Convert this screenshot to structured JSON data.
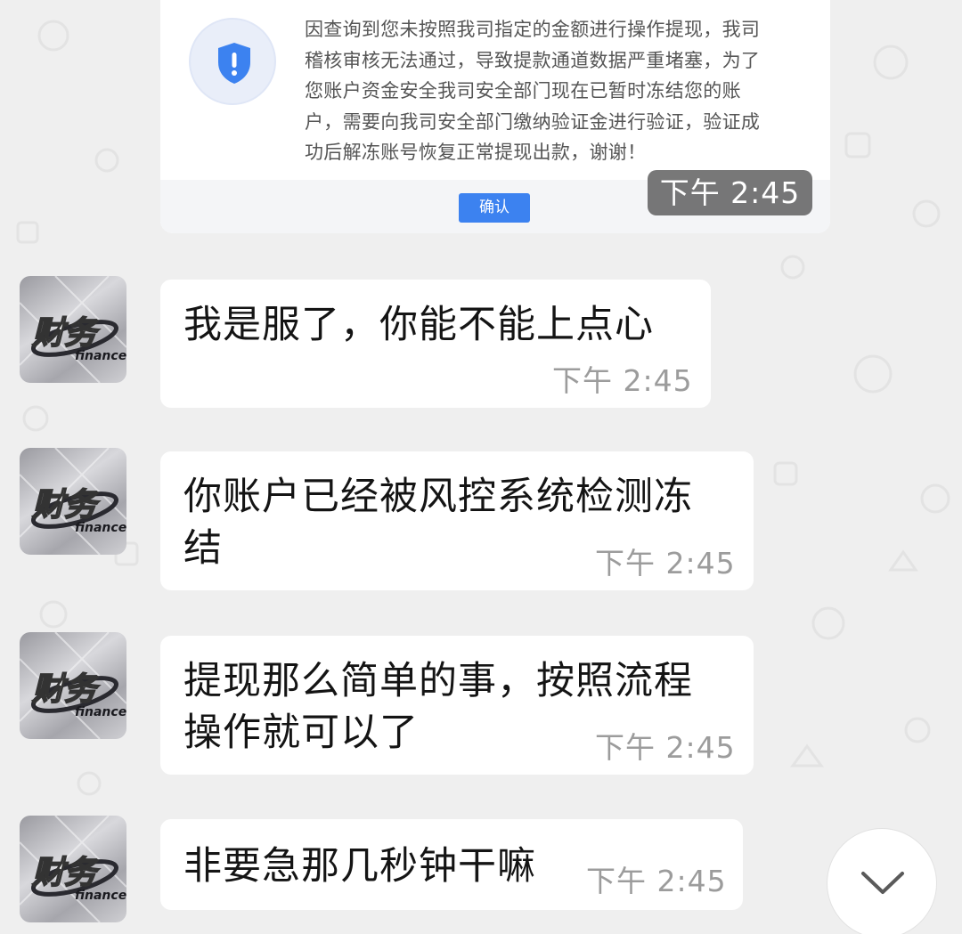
{
  "notice_card": {
    "lines": [
      "因查询到您未按照我司指定的金额进行操作提现，我司",
      "稽核审核无法通过，导致提款通道数据严重堵塞，为了",
      "您账户资金安全我司安全部门现在已暂时冻结您的账",
      "户，需要向我司安全部门缴纳验证金进行验证，验证成",
      "功后解冻账号恢复正常提现出款，谢谢！"
    ],
    "confirm_label": "确认",
    "time": "下午  2:45"
  },
  "avatar": {
    "main_text": "财务",
    "sub_text": "finance"
  },
  "messages": [
    {
      "lines": [
        "我是服了，你能不能上点心"
      ],
      "time": "下午  2:45"
    },
    {
      "lines": [
        "你账户已经被风控系统检测冻",
        "结"
      ],
      "time": "下午  2:45"
    },
    {
      "lines": [
        "提现那么简单的事，按照流程",
        "操作就可以了"
      ],
      "time": "下午  2:45"
    },
    {
      "lines": [
        "非要急那几秒钟干嘛"
      ],
      "time": "下午  2:45"
    }
  ],
  "colors": {
    "background": "#efefef",
    "bubble": "#ffffff",
    "time_text": "#9c9c9c",
    "confirm_button": "#3c82f0",
    "shield": "#3c82f0"
  },
  "icons": {
    "shield": "shield-alert-icon",
    "scroll": "chevron-down-icon"
  }
}
